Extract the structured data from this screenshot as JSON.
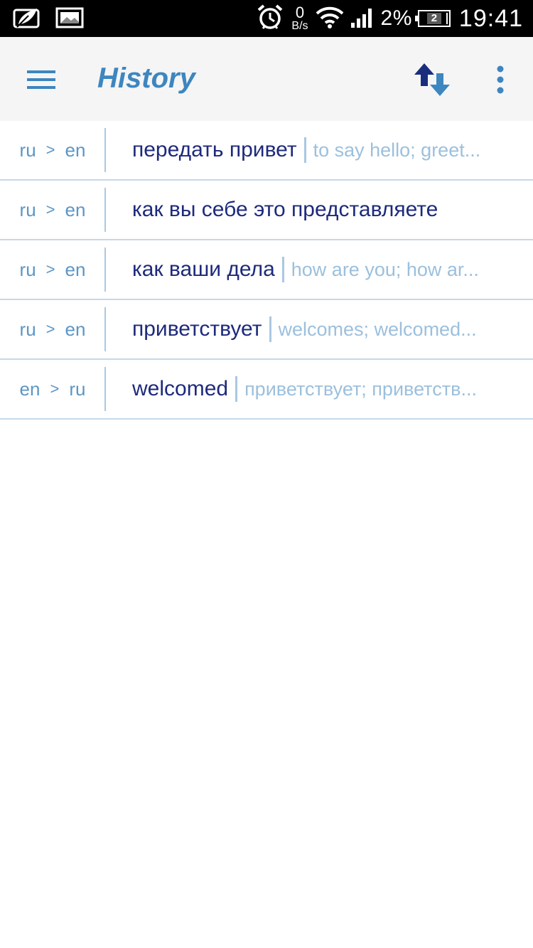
{
  "status_bar": {
    "net_rate": "0",
    "net_unit": "B/s",
    "battery_percent": "2%",
    "battery_badge": "2",
    "time": "19:41",
    "icons": [
      "leaf-notification-icon",
      "image-notification-icon",
      "alarm-icon",
      "wifi-icon",
      "signal-icon",
      "battery-icon"
    ]
  },
  "toolbar": {
    "title": "History",
    "icons": [
      "menu-icon",
      "swap-languages-icon",
      "more-options-icon"
    ],
    "accent_color": "#3d86c0"
  },
  "history": {
    "items": [
      {
        "from": "ru",
        "to": "en",
        "term": "передать привет",
        "translation": "to say hello; greet..."
      },
      {
        "from": "ru",
        "to": "en",
        "term": "как вы себе это представляете",
        "translation": ""
      },
      {
        "from": "ru",
        "to": "en",
        "term": "как ваши дела",
        "translation": "how are you; how ar..."
      },
      {
        "from": "ru",
        "to": "en",
        "term": "приветствует",
        "translation": "welcomes; welcomed..."
      },
      {
        "from": "en",
        "to": "ru",
        "term": "welcomed",
        "translation": "приветствует; приветств..."
      }
    ],
    "arrow": ">",
    "colors": {
      "term": "#1d2a7c",
      "translation": "#9cc0dd",
      "lang": "#5b96c6",
      "divider": "#c5d8e8"
    }
  }
}
